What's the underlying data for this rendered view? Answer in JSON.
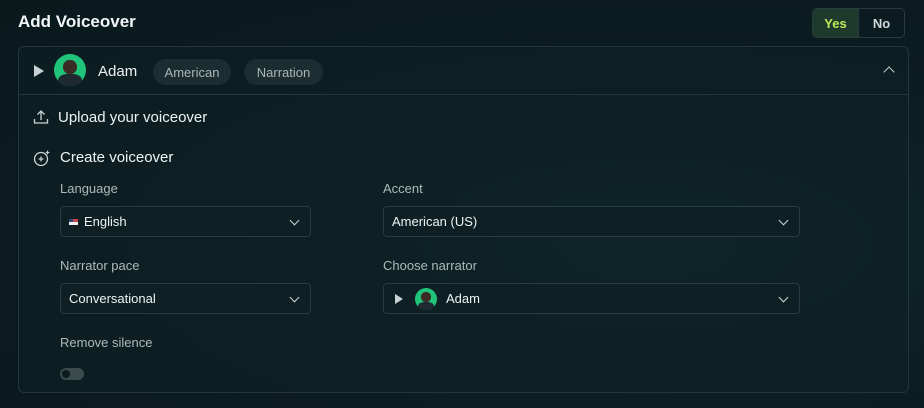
{
  "header": {
    "title": "Add Voiceover",
    "toggle": {
      "yes": "Yes",
      "no": "No",
      "selected": "Yes"
    }
  },
  "narrator_card": {
    "name": "Adam",
    "tags": [
      "American",
      "Narration"
    ]
  },
  "options": {
    "upload_label": "Upload your voiceover",
    "create_label": "Create voiceover"
  },
  "form": {
    "language": {
      "label": "Language",
      "value": "English"
    },
    "accent": {
      "label": "Accent",
      "value": "American (US)"
    },
    "pace": {
      "label": "Narrator pace",
      "value": "Conversational"
    },
    "narrator": {
      "label": "Choose narrator",
      "value": "Adam"
    },
    "remove_silence": {
      "label": "Remove silence",
      "on": false
    }
  },
  "colors": {
    "accent_green": "#bfe85a",
    "avatar_green": "#1fc47a",
    "background": "#0c1e22"
  },
  "icons": [
    "play-icon",
    "upload-icon",
    "create-sparkle-icon",
    "chevron-up-icon",
    "chevron-down-icon",
    "us-flag-icon"
  ]
}
